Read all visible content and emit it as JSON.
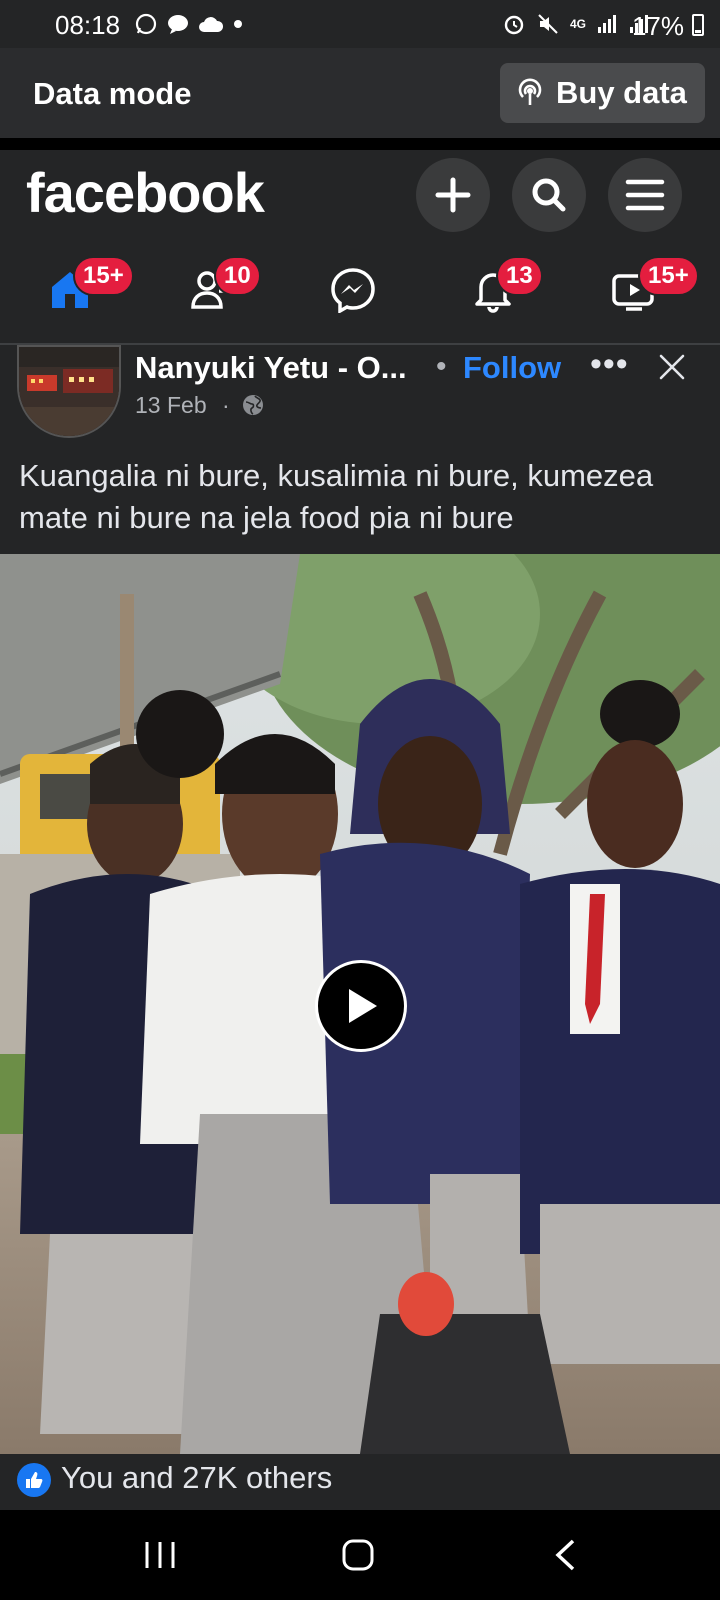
{
  "status_bar": {
    "time": "08:18",
    "battery": "17%",
    "network": "4G"
  },
  "data_mode": {
    "label": "Data mode",
    "buy_label": "Buy data"
  },
  "header": {
    "logo": "facebook"
  },
  "nav_tabs": [
    {
      "name": "home",
      "badge": "15+"
    },
    {
      "name": "friends",
      "badge": "10"
    },
    {
      "name": "messenger",
      "badge": ""
    },
    {
      "name": "notifications",
      "badge": "13"
    },
    {
      "name": "video",
      "badge": "15+"
    }
  ],
  "post": {
    "author": "Nanyuki Yetu - O...",
    "separator": "•",
    "follow_label": "Follow",
    "date": "13 Feb",
    "date_sep": "·",
    "text": "Kuangalia ni bure, kusalimia ni bure, kumezea mate ni bure na jela food pia ni bure",
    "likes": "You and 27K others"
  },
  "colors": {
    "accent": "#2d88ff",
    "badge": "#e41e3f",
    "background": "#242526"
  }
}
